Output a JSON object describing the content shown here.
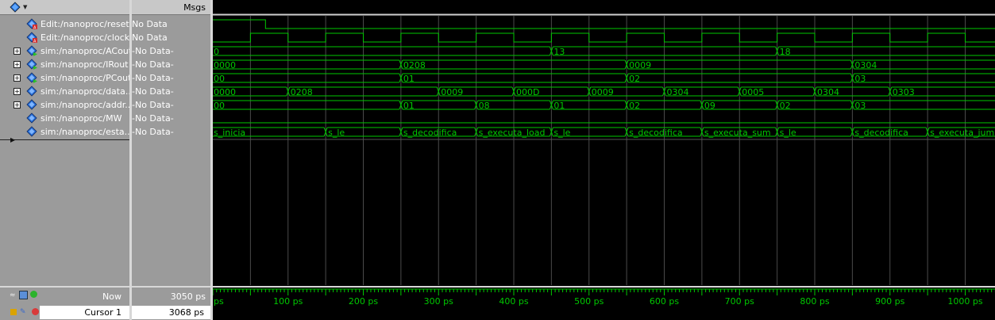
{
  "header": {
    "msgs_title": "Msgs",
    "toolbar_icon": "wave-toolbar-icon"
  },
  "signals": [
    {
      "name": "Edit:/nanoproc/reset",
      "msg": "No Data",
      "kind": "edit",
      "expandable": false
    },
    {
      "name": "Edit:/nanoproc/clock",
      "msg": "No Data",
      "kind": "edit",
      "expandable": false
    },
    {
      "name": "sim:/nanoproc/ACout",
      "msg": "-No Data-",
      "kind": "sim-out",
      "expandable": true
    },
    {
      "name": "sim:/nanoproc/IRout",
      "msg": "-No Data-",
      "kind": "sim-out",
      "expandable": true
    },
    {
      "name": "sim:/nanoproc/PCout",
      "msg": "-No Data-",
      "kind": "sim-out",
      "expandable": true
    },
    {
      "name": "sim:/nanoproc/data...",
      "msg": "-No Data-",
      "kind": "sim",
      "expandable": true
    },
    {
      "name": "sim:/nanoproc/addr...",
      "msg": "-No Data-",
      "kind": "sim",
      "expandable": true
    },
    {
      "name": "sim:/nanoproc/MW",
      "msg": "-No Data-",
      "kind": "sim",
      "expandable": false
    },
    {
      "name": "sim:/nanoproc/esta...",
      "msg": "-No Data-",
      "kind": "sim",
      "expandable": false
    }
  ],
  "bottom": {
    "now_label": "Now",
    "now_value": "3050 ps",
    "cursor_label": "Cursor 1",
    "cursor_value": "3068 ps"
  },
  "timeline": {
    "start_label": "ps",
    "tick_labels": [
      "100 ps",
      "200 ps",
      "300 ps",
      "400 ps",
      "500 ps",
      "600 ps",
      "700 ps",
      "800 ps",
      "900 ps",
      "1000 ps"
    ]
  },
  "waves": {
    "ACout": [
      {
        "t": 0,
        "v": "0"
      },
      {
        "t": 450,
        "v": "13"
      },
      {
        "t": 750,
        "v": "18"
      }
    ],
    "IRout": [
      {
        "t": 0,
        "v": "0000"
      },
      {
        "t": 250,
        "v": "0208"
      },
      {
        "t": 550,
        "v": "0009"
      },
      {
        "t": 850,
        "v": "0304"
      }
    ],
    "PCout": [
      {
        "t": 0,
        "v": "00"
      },
      {
        "t": 250,
        "v": "01"
      },
      {
        "t": 550,
        "v": "02"
      },
      {
        "t": 850,
        "v": "03"
      }
    ],
    "data": [
      {
        "t": 0,
        "v": "0000"
      },
      {
        "t": 100,
        "v": "0208"
      },
      {
        "t": 300,
        "v": "0009"
      },
      {
        "t": 400,
        "v": "000D"
      },
      {
        "t": 500,
        "v": "0009"
      },
      {
        "t": 600,
        "v": "0304"
      },
      {
        "t": 700,
        "v": "0005"
      },
      {
        "t": 800,
        "v": "0304"
      },
      {
        "t": 900,
        "v": "0303"
      }
    ],
    "addr": [
      {
        "t": 0,
        "v": "00"
      },
      {
        "t": 250,
        "v": "01"
      },
      {
        "t": 350,
        "v": "08"
      },
      {
        "t": 450,
        "v": "01"
      },
      {
        "t": 550,
        "v": "02"
      },
      {
        "t": 650,
        "v": "09"
      },
      {
        "t": 750,
        "v": "02"
      },
      {
        "t": 850,
        "v": "03"
      }
    ],
    "estado": [
      {
        "t": 0,
        "v": "s_inicia"
      },
      {
        "t": 150,
        "v": "s_le"
      },
      {
        "t": 250,
        "v": "s_decodifica"
      },
      {
        "t": 350,
        "v": "s_executa_load"
      },
      {
        "t": 450,
        "v": "s_le"
      },
      {
        "t": 550,
        "v": "s_decodifica"
      },
      {
        "t": 650,
        "v": "s_executa_sum"
      },
      {
        "t": 750,
        "v": "s_le"
      },
      {
        "t": 850,
        "v": "s_decodifica"
      },
      {
        "t": 950,
        "v": "s_executa_jump"
      }
    ]
  },
  "colors": {
    "wave": "#00c800",
    "background": "#000000",
    "panel": "#9b9b9b",
    "grid": "#4a4a4a"
  }
}
